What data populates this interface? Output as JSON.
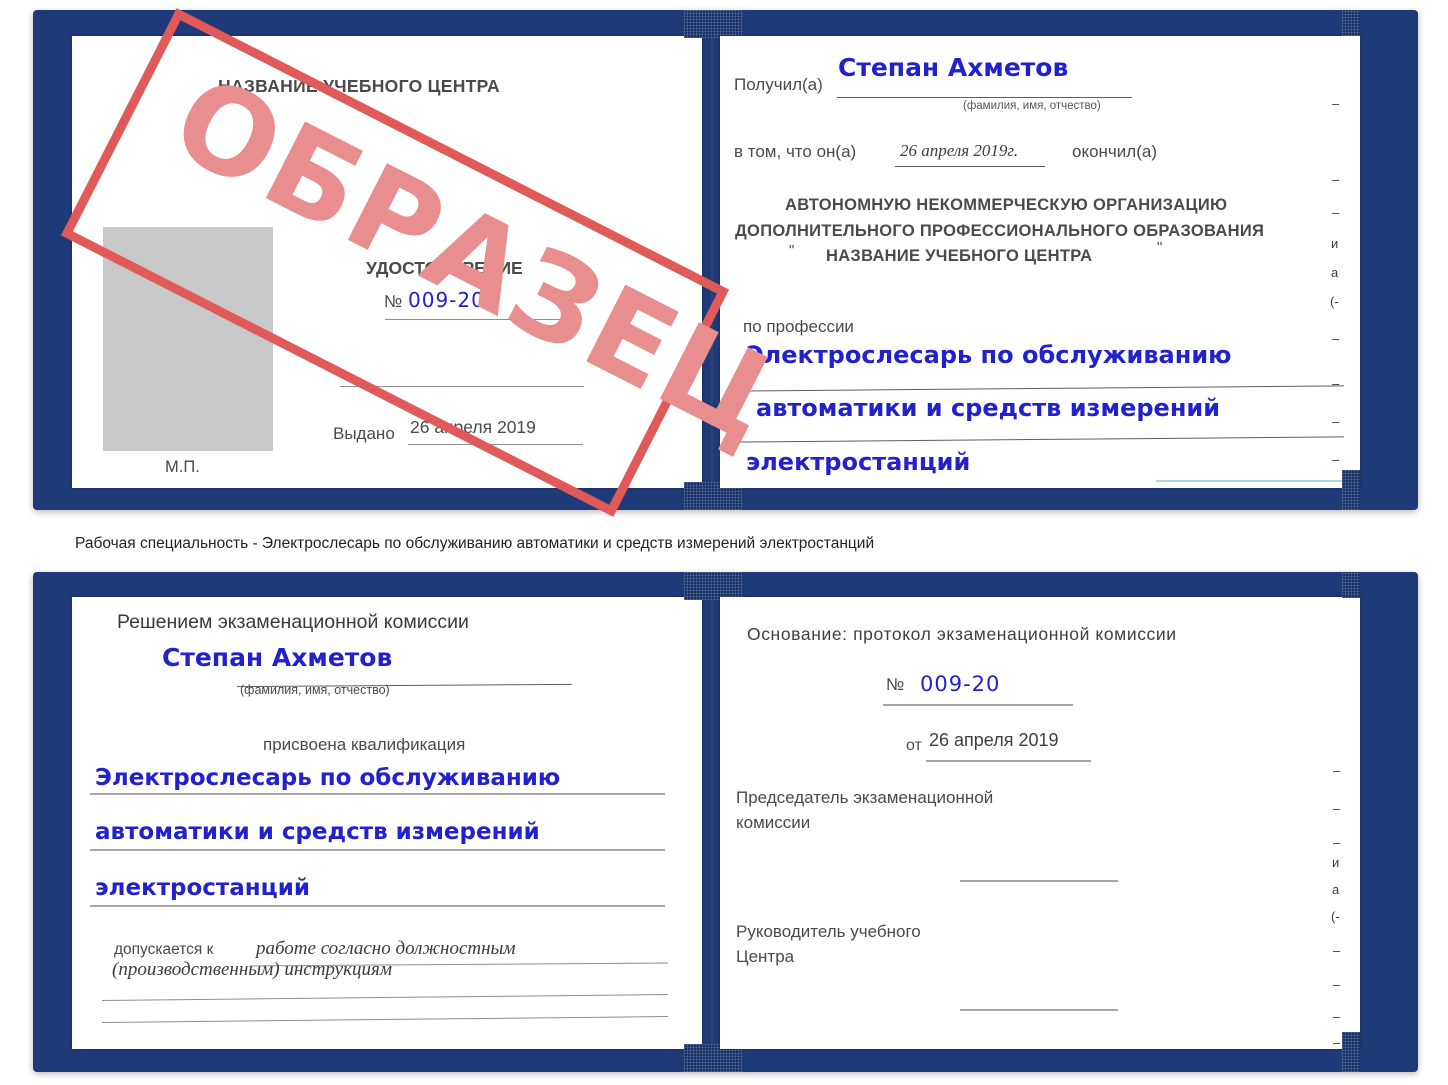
{
  "document": {
    "kind": "certificate-scan",
    "colors": {
      "cover_blue": "#1f3a78",
      "ink_blue": "#2222cc",
      "print_gray": "#4b4b4b",
      "stamp_red": "#e05a5a",
      "stamp_fill": "#e88e8e",
      "photo_placeholder": "#c9c9c9",
      "rule_gray": "#8e8e8e"
    }
  },
  "stamp": {
    "text": "ОБРАЗЕЦ"
  },
  "top_certificate": {
    "left_page": {
      "header": "НАЗВАНИЕ УЧЕБНОГО ЦЕНТРА",
      "title": "УДОСТОВЕРЕНИЕ",
      "number_label": "№",
      "number_value": "009-20",
      "issued_label": "Выдано",
      "issued_value": "26 апреля 2019",
      "seal_label": "М.П."
    },
    "right_page": {
      "received_label": "Получил(а)",
      "received_value": "Степан Ахметов",
      "fio_hint": "(фамилия, имя, отчество)",
      "that_he_label": "в том, что он(а)",
      "that_he_value": "26 апреля 2019г.",
      "graduated_label": "окончил(а)",
      "org_line1": "АВТОНОМНУЮ НЕКОММЕРЧЕСКУЮ ОРГАНИЗАЦИЮ",
      "org_line2": "ДОПОЛНИТЕЛЬНОГО ПРОФЕССИОНАЛЬНОГО ОБРАЗОВАНИЯ",
      "org_quote_open": "\"",
      "org_name": "НАЗВАНИЕ УЧЕБНОГО ЦЕНТРА",
      "org_quote_close": "\"",
      "profession_label": "по профессии",
      "profession_line1": "Электрослесарь по обслуживанию",
      "profession_line2": "автоматики и средств измерений",
      "profession_line3": "электростанций",
      "edge_fragments": [
        "–",
        "–",
        "–",
        "и",
        "а",
        "(-",
        "–",
        "–",
        "–",
        "–"
      ]
    }
  },
  "caption": {
    "text": "Рабочая специальность - Электрослесарь по обслуживанию автоматики и средств измерений электростанций"
  },
  "bottom_certificate": {
    "left_page": {
      "heading": "Решением экзаменационной комиссии",
      "name_value": "Степан Ахметов",
      "fio_hint": "(фамилия, имя, отчество)",
      "qualification_label": "присвоена квалификация",
      "qualification_line1": "Электрослесарь по обслуживанию",
      "qualification_line2": "автоматики и средств измерений",
      "qualification_line3": "электростанций",
      "admitted_label": "допускается к",
      "admitted_value_line1": "работе согласно должностным",
      "admitted_value_line2": "(производственным) инструкциям"
    },
    "right_page": {
      "basis_label": "Основание: протокол экзаменационной комиссии",
      "number_label": "№",
      "number_value": "009-20",
      "date_label": "от",
      "date_value": "26 апреля 2019",
      "chairman_line1": "Председатель экзаменационной",
      "chairman_line2": "комиссии",
      "head_line1": "Руководитель учебного",
      "head_line2": "Центра",
      "edge_fragments": [
        "–",
        "–",
        "–",
        "и",
        "а",
        "(-",
        "–",
        "–",
        "–",
        "–"
      ]
    }
  }
}
